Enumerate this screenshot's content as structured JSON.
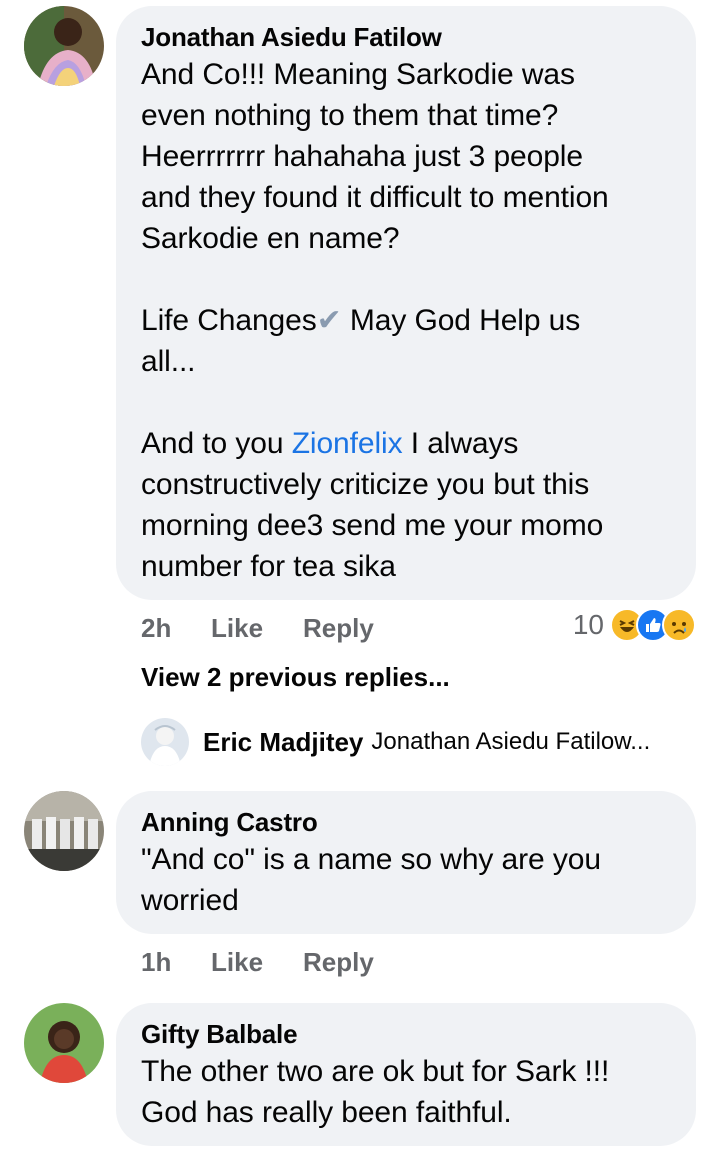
{
  "comments": [
    {
      "author": "Jonathan Asiedu Fatilow",
      "text_part1": "And Co!!! Meaning Sarkodie was\neven nothing to them that time?\nHeerrrrrrr hahahaha just 3 people\nand they found it difficult to mention\nSarkodie en name?\n\nLife Changes",
      "text_check": "✔",
      "text_part2": " May God Help us\nall...\n\nAnd to you ",
      "mention": "Zionfelix",
      "text_part3": " I always\nconstructively criticize you but this\nmorning dee3 send me your momo\nnumber for tea sika",
      "time": "2h",
      "like_label": "Like",
      "reply_label": "Reply",
      "reaction_count": "10",
      "reactions": [
        "haha-icon",
        "like-icon",
        "sad-icon"
      ]
    },
    {
      "author": "Anning Castro",
      "text": "\"And co\" is a name so why are you\nworried",
      "time": "1h",
      "like_label": "Like",
      "reply_label": "Reply"
    },
    {
      "author": "Gifty Balbale",
      "text": "The other two are ok but for Sark !!!\nGod has really been faithful."
    }
  ],
  "view_previous": "View 2 previous replies...",
  "latest_reply": {
    "author": "Eric Madjitey",
    "text": "Jonathan Asiedu Fatilow..."
  },
  "colors": {
    "bubble": "#f0f2f5",
    "meta": "#65676b",
    "mention": "#1b74e4",
    "like_blue": "#1877f2",
    "haha_yellow": "#f7b928"
  }
}
